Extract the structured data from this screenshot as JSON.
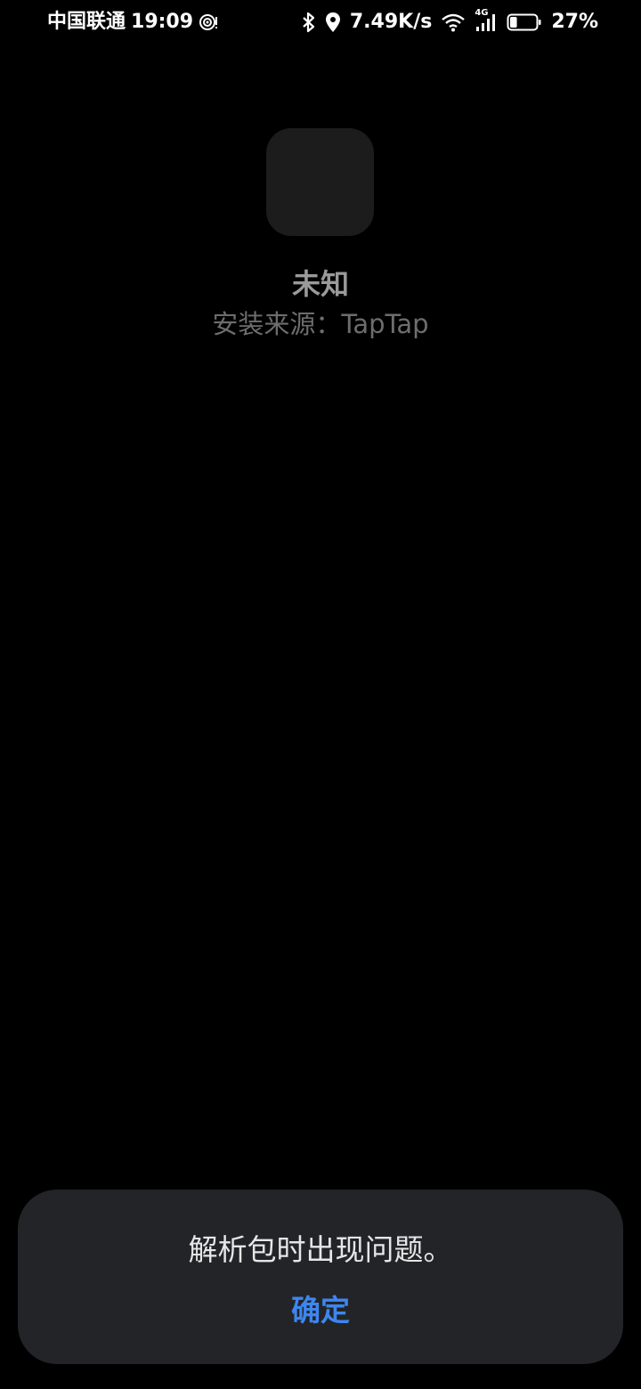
{
  "status_bar": {
    "carrier": "中国联通",
    "time": "19:09",
    "net_speed": "7.49K/s",
    "network_type": "4G",
    "battery_percent": "27%",
    "battery_level": 0.27,
    "icons": [
      "hotspot-icon",
      "bluetooth-icon",
      "location-icon",
      "wifi-icon",
      "cellular-signal-icon",
      "battery-icon"
    ]
  },
  "app": {
    "name": "未知",
    "install_source": "安装来源：TapTap"
  },
  "dialog": {
    "message": "解析包时出现问题。",
    "confirm_label": "确定"
  },
  "colors": {
    "background": "#000000",
    "dialog_background": "#232427",
    "accent": "#3d86f0"
  }
}
